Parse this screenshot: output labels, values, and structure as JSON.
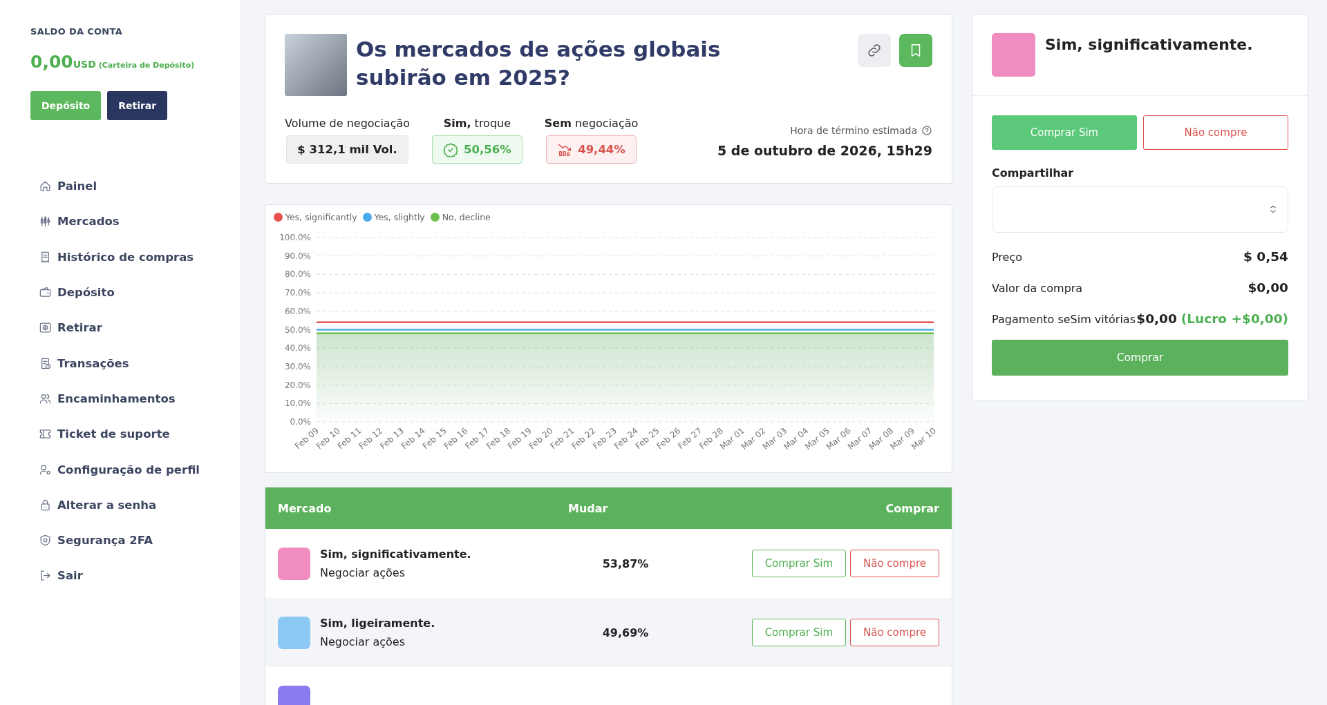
{
  "sidebar": {
    "balance_label": "SALDO DA CONTA",
    "balance": "0,00",
    "currency": "USD",
    "wallet": "(Carteira de Depósito)",
    "buttons": [
      "Depósito",
      "Retirar"
    ],
    "items": [
      {
        "label": "Painel"
      },
      {
        "label": "Mercados"
      },
      {
        "label": "Histórico de compras"
      },
      {
        "label": "Depósito"
      },
      {
        "label": "Retirar"
      },
      {
        "label": "Transações"
      },
      {
        "label": "Encaminhamentos"
      },
      {
        "label": "Ticket de suporte"
      },
      {
        "label": "Configuração de perfil"
      },
      {
        "label": "Alterar a senha"
      },
      {
        "label": "Segurança 2FA"
      },
      {
        "label": "Sair"
      }
    ]
  },
  "market": {
    "title": "Os mercados de ações globais subirão em 2025?",
    "stats": [
      {
        "kind": "volume",
        "label": "Volume de negociação",
        "value": "$ 312,1 mil Vol."
      },
      {
        "kind": "yes",
        "label": "**Sim,** troque",
        "value": "50,56%"
      },
      {
        "kind": "no",
        "label": "**Sem** negociação",
        "value": "49,44%"
      }
    ],
    "end_label": "Hora de término estimada",
    "end_time": "5 de outubro de 2026, 15h29"
  },
  "chart_data": {
    "type": "line",
    "categories": [
      "Feb 09",
      "Feb 10",
      "Feb 11",
      "Feb 12",
      "Feb 13",
      "Feb 14",
      "Feb 15",
      "Feb 16",
      "Feb 17",
      "Feb 18",
      "Feb 19",
      "Feb 20",
      "Feb 21",
      "Feb 22",
      "Feb 23",
      "Feb 24",
      "Feb 25",
      "Feb 26",
      "Feb 27",
      "Feb 28",
      "Mar 01",
      "Mar 02",
      "Mar 03",
      "Mar 04",
      "Mar 05",
      "Mar 06",
      "Mar 07",
      "Mar 08",
      "Mar 09",
      "Mar 10"
    ],
    "series": [
      {
        "name": "Yes, significantly",
        "color": "#e8504f",
        "values": [
          54,
          54,
          54,
          54,
          54,
          54,
          54,
          54,
          54,
          54,
          54,
          54,
          54,
          54,
          54,
          54,
          54,
          54,
          54,
          54,
          54,
          54,
          54,
          54,
          54,
          54,
          54,
          54,
          54,
          54
        ]
      },
      {
        "name": "Yes, slightly",
        "color": "#4aaaf0",
        "values": [
          50,
          50,
          50,
          50,
          50,
          50,
          50,
          50,
          50,
          50,
          50,
          50,
          50,
          50,
          50,
          50,
          50,
          50,
          50,
          50,
          50,
          50,
          50,
          50,
          50,
          50,
          50,
          50,
          50,
          50
        ]
      },
      {
        "name": "No, decline",
        "color": "#6cc04a",
        "values": [
          48,
          48,
          48,
          48,
          48,
          48,
          48,
          48,
          48,
          48,
          48,
          48,
          48,
          48,
          48,
          48,
          48,
          48,
          48,
          48,
          48,
          48,
          48,
          48,
          48,
          48,
          48,
          48,
          48,
          48
        ]
      }
    ],
    "ylim": [
      0,
      100
    ],
    "grid": true,
    "legend": true,
    "yticks": [
      {
        "value": 0,
        "label": "0.0%"
      },
      {
        "value": 10,
        "label": "10.0%"
      },
      {
        "value": 20,
        "label": "20.0%"
      },
      {
        "value": 30,
        "label": "30.0%"
      },
      {
        "value": 40,
        "label": "40.0%"
      },
      {
        "value": 50,
        "label": "50.0%"
      },
      {
        "value": 60,
        "label": "60.0%"
      },
      {
        "value": 70,
        "label": "70.0%"
      },
      {
        "value": 80,
        "label": "80.0%"
      },
      {
        "value": 90,
        "label": "90.0%"
      },
      {
        "value": 100,
        "label": "100.0%"
      }
    ]
  },
  "table": {
    "columns": [
      "Mercado",
      "Mudar",
      "Comprar"
    ],
    "rows": [
      {
        "name": "Sim, significativamente.",
        "subtitle": "Negociar ações",
        "change": "53,87%",
        "buy": "Comprar Sim",
        "sell": "Não compre",
        "color": "#f08cc0"
      },
      {
        "name": "Sim, ligeiramente.",
        "subtitle": "Negociar ações",
        "change": "49,69%",
        "buy": "Comprar Sim",
        "sell": "Não compre",
        "color": "#8cc8f4"
      },
      {
        "color": "#8a7cf0"
      }
    ]
  },
  "order": {
    "outcome": "Sim, significativamente.",
    "color": "#f08cc0",
    "sides": [
      {
        "label": "Comprar Sim",
        "kind": "yes",
        "selected": true
      },
      {
        "label": "Não compre",
        "kind": "no",
        "selected": false
      }
    ],
    "share_label": "Compartilhar",
    "lines": [
      {
        "label": "Preço",
        "value": "$ 0,54"
      },
      {
        "label": "Valor da compra",
        "value": "$0,00"
      },
      {
        "label": "Pagamento seSim vitórias",
        "value": "$0,00",
        "note": "(Lucro +$0,00)"
      }
    ],
    "submit": "Comprar"
  }
}
